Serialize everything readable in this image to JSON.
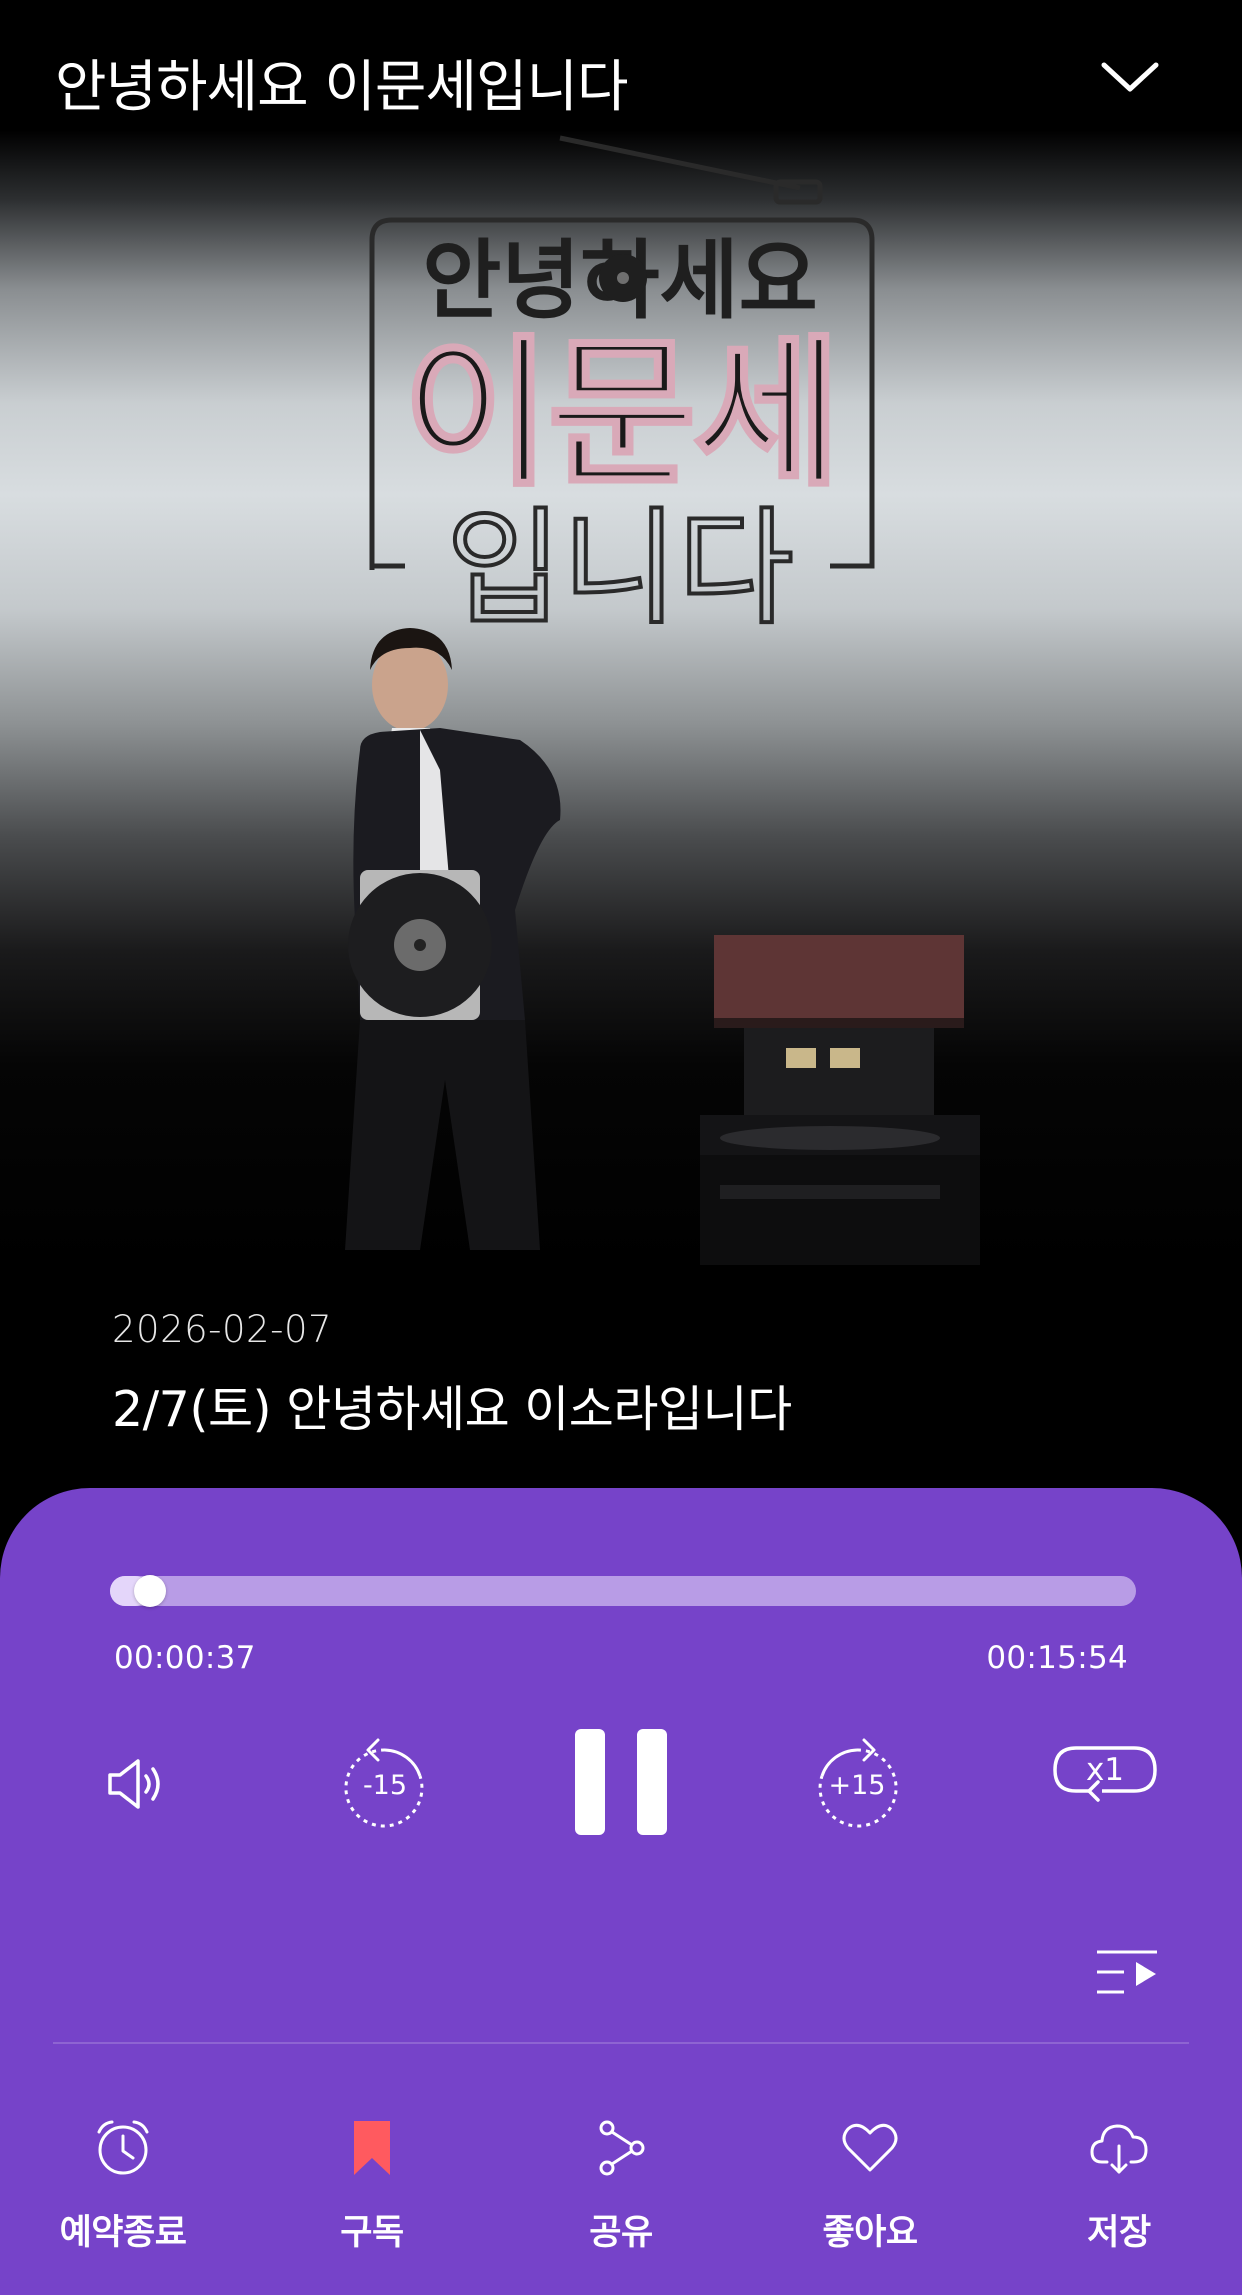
{
  "header": {
    "title": "안녕하세요 이문세입니다"
  },
  "artwork": {
    "logo_line1": "안녕하세요",
    "logo_line2": "이문세",
    "logo_line3": "입니다"
  },
  "episode": {
    "date": "2026-02-07",
    "title": "2/7(토) 안녕하세요 이소라입니다"
  },
  "player": {
    "current_time": "00:00:37",
    "total_time": "00:15:54",
    "progress": 0.039,
    "rewind_label": "-15",
    "forward_label": "+15",
    "speed_label": "x1",
    "state": "playing"
  },
  "actions": [
    {
      "label": "예약종료",
      "icon": "alarm-clock-icon"
    },
    {
      "label": "구독",
      "icon": "bookmark-icon"
    },
    {
      "label": "공유",
      "icon": "share-icon"
    },
    {
      "label": "좋아요",
      "icon": "heart-icon"
    },
    {
      "label": "저장",
      "icon": "cloud-download-icon"
    }
  ],
  "colors": {
    "panel": "#7643c9",
    "track": "#b89ce6",
    "accent_bookmark": "#ff5a5f"
  }
}
